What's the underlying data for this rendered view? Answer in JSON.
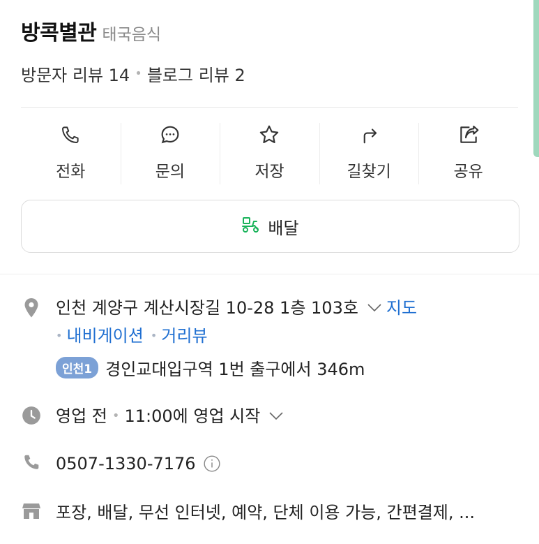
{
  "place": {
    "name": "방콕별관",
    "category": "태국음식"
  },
  "reviews": {
    "visitor": "방문자 리뷰 14",
    "blog": "블로그 리뷰 2"
  },
  "actions": [
    {
      "label": "전화",
      "icon": "phone-icon"
    },
    {
      "label": "문의",
      "icon": "chat-icon"
    },
    {
      "label": "저장",
      "icon": "star-icon"
    },
    {
      "label": "길찾기",
      "icon": "directions-icon"
    },
    {
      "label": "공유",
      "icon": "share-icon"
    }
  ],
  "delivery": {
    "label": "배달",
    "icon": "delivery-scooter-icon",
    "icon_color": "#19b35a"
  },
  "address": {
    "text": "인천 계양구 계산시장길 10-28 1층 103호",
    "map_link": "지도",
    "navigation_link": "내비게이션",
    "street_view_link": "거리뷰"
  },
  "subway": {
    "line_badge": "인천1",
    "badge_color": "#7ca1d6",
    "directions": "경인교대입구역 1번 출구에서 346m"
  },
  "hours": {
    "status": "영업 전",
    "detail": "11:00에 영업 시작"
  },
  "phone": {
    "number": "0507-1330-7176"
  },
  "amenities": {
    "text": "포장, 배달, 무선 인터넷, 예약, 단체 이용 가능, 간편결제, ..."
  },
  "colors": {
    "link": "#1f6fd1",
    "icon_gray": "#9a9a9a",
    "scroll_accent": "#9fd8bd"
  }
}
